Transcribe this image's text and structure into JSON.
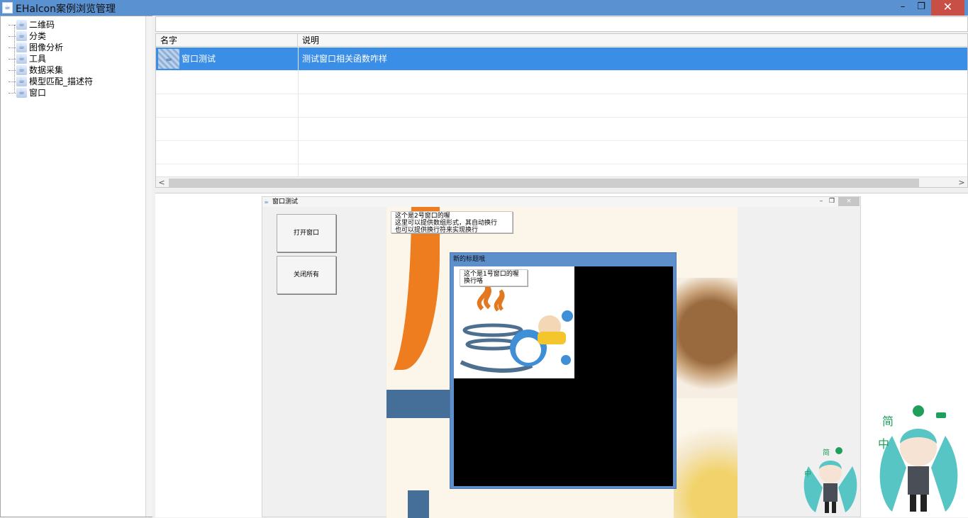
{
  "app": {
    "title": "EHalcon案例浏览管理",
    "controls": {
      "minimize": "–",
      "maximize": "❐",
      "close": "✕"
    }
  },
  "tree": {
    "items": [
      {
        "label": "二维码",
        "icon": "java-icon"
      },
      {
        "label": "分类",
        "icon": "java-icon"
      },
      {
        "label": "图像分析",
        "icon": "java-icon"
      },
      {
        "label": "工具",
        "icon": "java-icon"
      },
      {
        "label": "数据采集",
        "icon": "java-icon"
      },
      {
        "label": "模型匹配_描述符",
        "icon": "java-icon"
      },
      {
        "label": "窗口",
        "icon": "java-icon"
      }
    ]
  },
  "table": {
    "headers": {
      "name": "名字",
      "desc": "说明"
    },
    "rows": [
      {
        "name": "窗口测试",
        "desc": "测试窗口相关函数咋样",
        "selected": true
      }
    ],
    "selected_color": "#3a8ee6"
  },
  "scroll": {
    "left_arrow": "<",
    "right_arrow": ">"
  },
  "inner_window": {
    "title": "窗口测试",
    "controls": {
      "minimize": "–",
      "maximize": "❐",
      "close": "×"
    },
    "buttons": {
      "open": "打开窗口",
      "close_all": "关闭所有"
    },
    "note2": "这个是2号窗口的喔\n这里可以提供数组形式，其自动换行\n也可以提供换行符来实现换行"
  },
  "window1": {
    "title": "新的标题哦",
    "note": "这个是1号窗口的喔\n换行咯"
  },
  "ime_widget": {
    "small_label_1": "简",
    "small_label_2": "中",
    "large_label_1": "简",
    "large_label_2": "中",
    "accent_color": "#1f9f5a"
  }
}
